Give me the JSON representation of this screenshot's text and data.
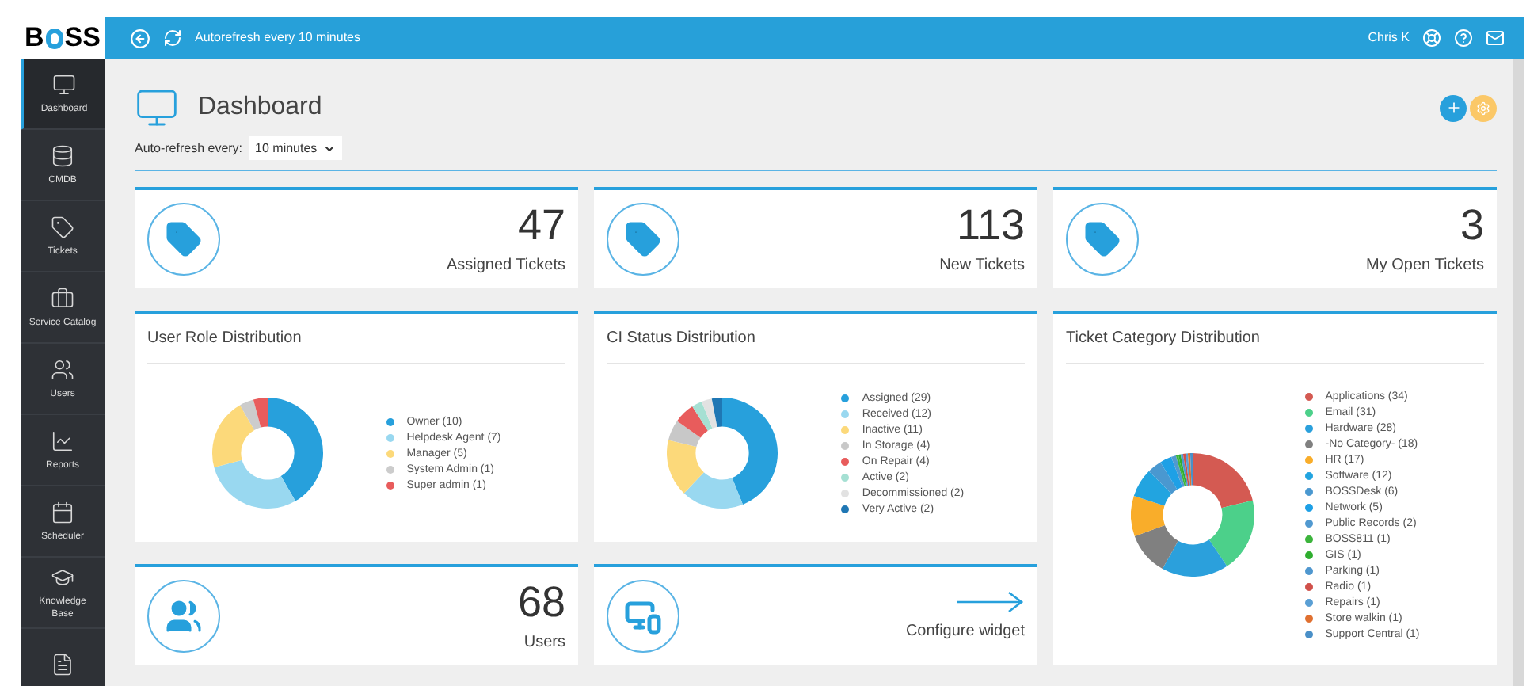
{
  "topbar": {
    "logo": "B",
    "logo_rest": "SS",
    "refresh_text": "Autorefresh every 10 minutes",
    "user": "Chris K"
  },
  "sidebar": {
    "items": [
      {
        "kind": "monitor",
        "label": "Dashboard",
        "selected": true
      },
      {
        "kind": "database",
        "label": "CMDB",
        "selected": false
      },
      {
        "kind": "tag",
        "label": "Tickets",
        "selected": false
      },
      {
        "kind": "briefcase",
        "label": "Service Catalog",
        "selected": false
      },
      {
        "kind": "users",
        "label": "Users",
        "selected": false
      },
      {
        "kind": "chart",
        "label": "Reports",
        "selected": false
      },
      {
        "kind": "calendar",
        "label": "Scheduler",
        "selected": false
      },
      {
        "kind": "cap",
        "label": "Knowledge Base",
        "selected": false
      },
      {
        "kind": "form"
      }
    ]
  },
  "page": {
    "title": "Dashboard",
    "refresh_label": "Auto-refresh every:",
    "refresh_value": "10 minutes"
  },
  "stats": [
    {
      "kind": "tag",
      "value": "47",
      "label": "Assigned Tickets"
    },
    {
      "kind": "tag",
      "value": "113",
      "label": "New Tickets"
    },
    {
      "kind": "tag",
      "value": "3",
      "label": "My Open Tickets"
    }
  ],
  "charts": [
    {
      "chart_data": {
        "type": "donut",
        "title": "User Role Distribution",
        "categories": [
          "Owner (10)",
          "Helpdesk Agent (7)",
          "Manager (5)",
          "System Admin (1)",
          "Super admin (1)"
        ],
        "values": [
          10,
          7,
          5,
          1,
          1
        ],
        "colors": [
          "#27a0dc",
          "#99d8f0",
          "#fcd97a",
          "#cccccc",
          "#e85c5c"
        ]
      }
    },
    {
      "chart_data": {
        "type": "donut",
        "title": "CI Status Distribution",
        "categories": [
          "Assigned (29)",
          "Received (12)",
          "Inactive (11)",
          "In Storage (4)",
          "On Repair (4)",
          "Active (2)",
          "Decommissioned (2)",
          "Very Active (2)"
        ],
        "values": [
          29,
          12,
          11,
          4,
          4,
          2,
          2,
          2
        ],
        "colors": [
          "#27a0dc",
          "#99d8f0",
          "#fcd97a",
          "#c8c8c8",
          "#e85c5c",
          "#a5e0d3",
          "#e2e2e2",
          "#1f77b4"
        ]
      }
    },
    {
      "chart_data": {
        "type": "donut",
        "title": "Ticket Category Distribution",
        "categories": [
          "Applications (34)",
          "Email (31)",
          "Hardware (28)",
          "-No Category- (18)",
          "HR (17)",
          "Software (12)",
          "BOSSDesk (6)",
          "Network (5)",
          "Public Records (2)",
          "BOSS811 (1)",
          "GIS (1)",
          "Parking (1)",
          "Radio (1)",
          "Repairs (1)",
          "Store walkin (1)",
          "Support Central (1)"
        ],
        "values": [
          34,
          31,
          28,
          18,
          17,
          12,
          6,
          5,
          2,
          1,
          1,
          1,
          1,
          1,
          1,
          1
        ],
        "colors": [
          "#d45a52",
          "#4cd08a",
          "#2ba0dc",
          "#808080",
          "#f9ad2a",
          "#22a4e0",
          "#4a98d0",
          "#1ea0e6",
          "#5199d0",
          "#3cb43c",
          "#2fae2f",
          "#4f97cf",
          "#d0504a",
          "#5a9fd4",
          "#e07030",
          "#4a90c8"
        ]
      }
    }
  ],
  "bottom": [
    {
      "kind": "users",
      "value": "68",
      "label": "Users"
    },
    {
      "kind": "devices",
      "label": "Configure widget"
    }
  ]
}
